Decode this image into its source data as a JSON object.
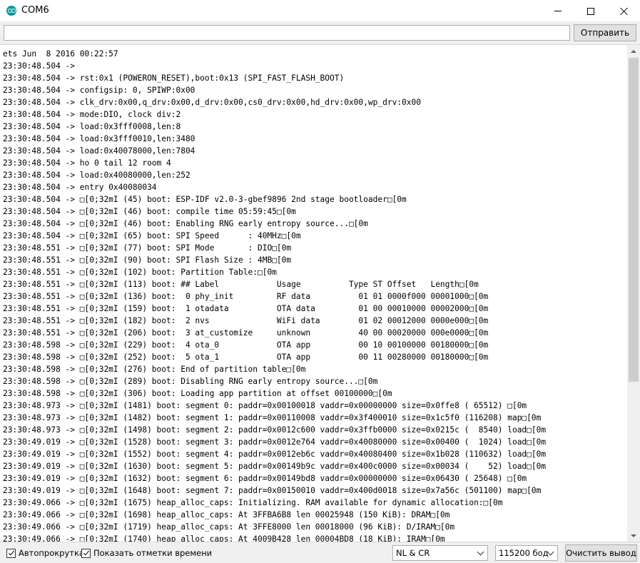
{
  "window": {
    "title": "COM6",
    "app_icon": "arduino-icon"
  },
  "send_bar": {
    "input_value": "",
    "send_label": "Отправить"
  },
  "monitor": {
    "lines": [
      "ets Jun  8 2016 00:22:57",
      "23:30:48.504 -> ",
      "23:30:48.504 -> rst:0x1 (POWERON_RESET),boot:0x13 (SPI_FAST_FLASH_BOOT)",
      "23:30:48.504 -> configsip: 0, SPIWP:0x00",
      "23:30:48.504 -> clk_drv:0x00,q_drv:0x00,d_drv:0x00,cs0_drv:0x00,hd_drv:0x00,wp_drv:0x00",
      "23:30:48.504 -> mode:DIO, clock div:2",
      "23:30:48.504 -> load:0x3fff0008,len:8",
      "23:30:48.504 -> load:0x3fff0010,len:3480",
      "23:30:48.504 -> load:0x40078000,len:7804",
      "23:30:48.504 -> ho 0 tail 12 room 4",
      "23:30:48.504 -> load:0x40080000,len:252",
      "23:30:48.504 -> entry 0x40080034",
      "23:30:48.504 -> □[0;32mI (45) boot: ESP-IDF v2.0-3-gbef9896 2nd stage bootloader□[0m",
      "23:30:48.504 -> □[0;32mI (46) boot: compile time 05:59:45□[0m",
      "23:30:48.504 -> □[0;32mI (46) boot: Enabling RNG early entropy source...□[0m",
      "23:30:48.504 -> □[0;32mI (65) boot: SPI Speed      : 40MHz□[0m",
      "23:30:48.551 -> □[0;32mI (77) boot: SPI Mode       : DIO□[0m",
      "23:30:48.551 -> □[0;32mI (90) boot: SPI Flash Size : 4MB□[0m",
      "23:30:48.551 -> □[0;32mI (102) boot: Partition Table:□[0m",
      "23:30:48.551 -> □[0;32mI (113) boot: ## Label            Usage          Type ST Offset   Length□[0m",
      "23:30:48.551 -> □[0;32mI (136) boot:  0 phy_init         RF data          01 01 0000f000 00001000□[0m",
      "23:30:48.551 -> □[0;32mI (159) boot:  1 otadata          OTA data         01 00 00010000 00002000□[0m",
      "23:30:48.551 -> □[0;32mI (182) boot:  2 nvs              WiFi data        01 02 00012000 0000e000□[0m",
      "23:30:48.551 -> □[0;32mI (206) boot:  3 at_customize     unknown          40 00 00020000 000e0000□[0m",
      "23:30:48.598 -> □[0;32mI (229) boot:  4 ota_0            OTA app          00 10 00100000 00180000□[0m",
      "23:30:48.598 -> □[0;32mI (252) boot:  5 ota_1            OTA app          00 11 00280000 00180000□[0m",
      "23:30:48.598 -> □[0;32mI (276) boot: End of partition table□[0m",
      "23:30:48.598 -> □[0;32mI (289) boot: Disabling RNG early entropy source...□[0m",
      "23:30:48.598 -> □[0;32mI (306) boot: Loading app partition at offset 00100000□[0m",
      "23:30:48.973 -> □[0;32mI (1481) boot: segment 0: paddr=0x00100018 vaddr=0x00000000 size=0x0ffe8 ( 65512) □[0m",
      "23:30:48.973 -> □[0;32mI (1482) boot: segment 1: paddr=0x00110008 vaddr=0x3f400010 size=0x1c5f0 (116208) map□[0m",
      "23:30:48.973 -> □[0;32mI (1498) boot: segment 2: paddr=0x0012c600 vaddr=0x3ffb0000 size=0x0215c (  8540) load□[0m",
      "23:30:49.019 -> □[0;32mI (1528) boot: segment 3: paddr=0x0012e764 vaddr=0x40080000 size=0x00400 (  1024) load□[0m",
      "23:30:49.019 -> □[0;32mI (1552) boot: segment 4: paddr=0x0012eb6c vaddr=0x40080400 size=0x1b028 (110632) load□[0m",
      "23:30:49.019 -> □[0;32mI (1630) boot: segment 5: paddr=0x00149b9c vaddr=0x400c0000 size=0x00034 (    52) load□[0m",
      "23:30:49.019 -> □[0;32mI (1632) boot: segment 6: paddr=0x00149bd8 vaddr=0x00000000 size=0x06430 ( 25648) □[0m",
      "23:30:49.019 -> □[0;32mI (1648) boot: segment 7: paddr=0x00150010 vaddr=0x400d0018 size=0x7a56c (501100) map□[0m",
      "23:30:49.066 -> □[0;32mI (1675) heap_alloc_caps: Initializing. RAM available for dynamic allocation:□[0m",
      "23:30:49.066 -> □[0;32mI (1698) heap_alloc_caps: At 3FFBA6B8 len 00025948 (150 KiB): DRAM□[0m",
      "23:30:49.066 -> □[0;32mI (1719) heap_alloc_caps: At 3FFE8000 len 00018000 (96 KiB): D/IRAM□[0m",
      "23:30:49.066 -> □[0;32mI (1740) heap_alloc_caps: At 4009B428 len 00004BD8 (18 KiB): IRAM□[0m"
    ]
  },
  "status_bar": {
    "autoscroll_label": "Автопрокрутка",
    "autoscroll_checked": true,
    "timestamps_label": "Показать отметки времени",
    "timestamps_checked": true,
    "line_ending": "NL & CR",
    "baud_rate": "115200 бод",
    "clear_label": "Очистить вывод"
  }
}
